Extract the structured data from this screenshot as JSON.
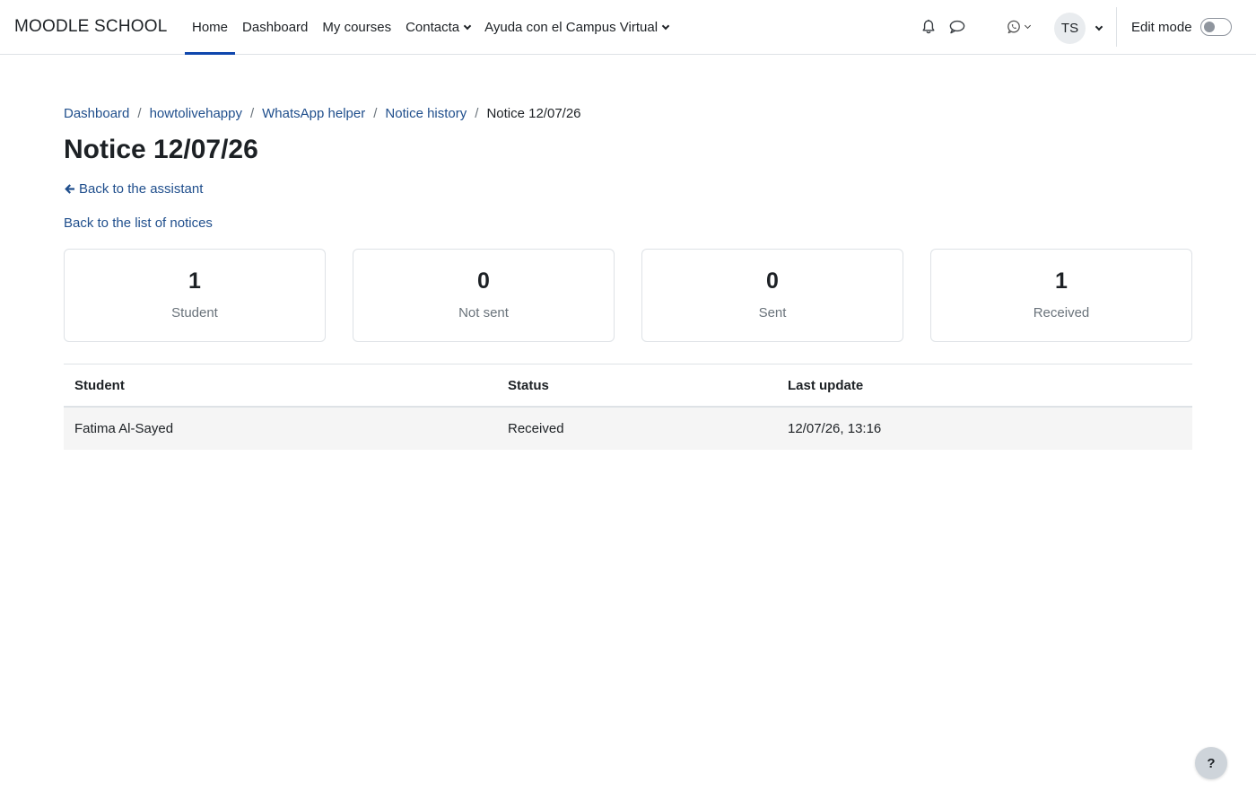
{
  "navbar": {
    "brand": "MOODLE SCHOOL",
    "items": [
      {
        "label": "Home",
        "active": true,
        "dropdown": false
      },
      {
        "label": "Dashboard",
        "active": false,
        "dropdown": false
      },
      {
        "label": "My courses",
        "active": false,
        "dropdown": false
      },
      {
        "label": "Contacta",
        "active": false,
        "dropdown": true
      },
      {
        "label": "Ayuda con el Campus Virtual",
        "active": false,
        "dropdown": true
      }
    ],
    "user_initials": "TS",
    "edit_mode_label": "Edit mode",
    "edit_mode_on": false,
    "icons": [
      "bell-icon",
      "chat-icon",
      "whatsapp-icon"
    ]
  },
  "breadcrumb": {
    "items": [
      "Dashboard",
      "howtolivehappy",
      "WhatsApp helper",
      "Notice history"
    ],
    "current": "Notice 12/07/26"
  },
  "page": {
    "title": "Notice 12/07/26",
    "back_assistant": "Back to the assistant",
    "back_list": "Back to the list of notices"
  },
  "stats": [
    {
      "value": "1",
      "label": "Student"
    },
    {
      "value": "0",
      "label": "Not sent"
    },
    {
      "value": "0",
      "label": "Sent"
    },
    {
      "value": "1",
      "label": "Received"
    }
  ],
  "table": {
    "headers": [
      "Student",
      "Status",
      "Last update"
    ],
    "rows": [
      [
        "Fatima Al-Sayed",
        "Received",
        "12/07/26, 13:16"
      ]
    ]
  },
  "help_label": "?",
  "colors": {
    "link": "#1f4e8c",
    "active_underline": "#0f47ad",
    "border": "#dee2e6",
    "muted": "#6a737b"
  }
}
